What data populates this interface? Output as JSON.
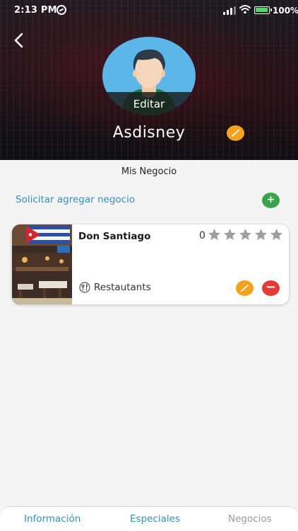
{
  "status_bar": {
    "time": "2:13 PM",
    "battery_percent": "100%",
    "battery_level": 1.0
  },
  "header": {
    "avatar_edit_label": "Editar",
    "profile_name": "Asdisney"
  },
  "main": {
    "section_title": "Mis Negocio",
    "request_link": "Solicitar agregar negocio",
    "add_button_label": "+"
  },
  "business": {
    "name": "Don Santiago",
    "rating_count": "0",
    "stars_total": 5,
    "stars_filled": 0,
    "category": "Restautants",
    "remove_button_label": "−"
  },
  "tabbar": {
    "tabs": [
      {
        "label": "Información"
      },
      {
        "label": "Especiales"
      },
      {
        "label": "Negocios"
      }
    ]
  },
  "colors": {
    "accent_blue": "#2f8fc4",
    "edit_orange": "#f3a31b",
    "add_green": "#3ba34a",
    "remove_red": "#e23b38",
    "star_gray": "#9e9e9e",
    "avatar_bg": "#5cb6e8"
  },
  "icons": [
    "back-icon",
    "sync-icon",
    "signal-icon",
    "wifi-icon",
    "battery-icon",
    "pencil-icon",
    "plus-icon",
    "minus-icon",
    "star-icon",
    "restaurant-icon"
  ]
}
